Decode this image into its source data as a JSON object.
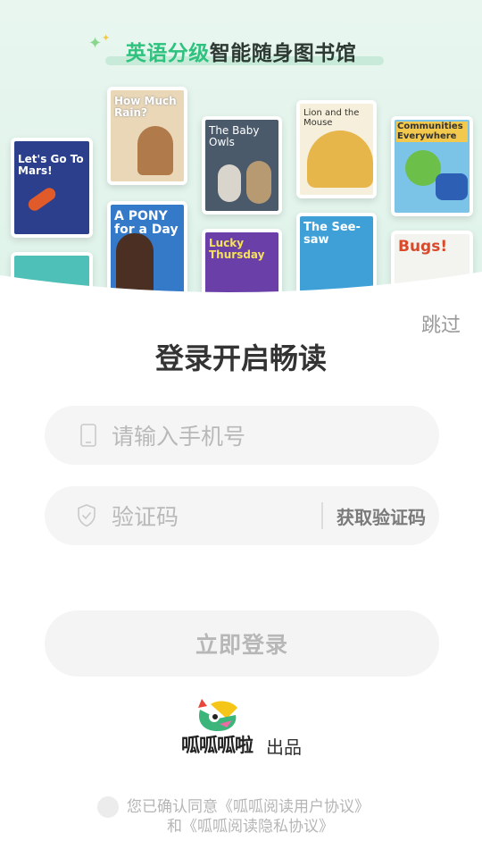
{
  "header": {
    "slogan_highlight": "英语分级",
    "slogan_tail": "智能随身图书馆"
  },
  "books": [
    {
      "title": "Let's Go To Mars!",
      "color": "#2b3f8c"
    },
    {
      "title": "How Much Rain?",
      "color": "#e9d7b8"
    },
    {
      "title": "The Baby Owls",
      "color": "#4a5a6b"
    },
    {
      "title": "Lion and the Mouse",
      "color": "#f5efdc"
    },
    {
      "title": "Communities Everywhere",
      "color": "#7bc4e8"
    },
    {
      "title": "A PONY for a Day",
      "color": "#3579c9"
    },
    {
      "title": "Lucky Thursday",
      "color": "#6b3fa8"
    },
    {
      "title": "The See-saw",
      "color": "#3fa0d8"
    },
    {
      "title": "Bugs!",
      "color": "#f3f3f0"
    }
  ],
  "login": {
    "skip_label": "跳过",
    "title": "登录开启畅读",
    "phone_placeholder": "请输入手机号",
    "code_placeholder": "验证码",
    "get_code_label": "获取验证码",
    "submit_label": "立即登录"
  },
  "brand": {
    "name": "呱呱呱啦",
    "suffix": "出品"
  },
  "agreement": {
    "prefix": "您已确认同意",
    "user_agreement": "《呱呱阅读用户协议》",
    "conjunction": "和",
    "privacy_agreement": "《呱呱阅读隐私协议》"
  }
}
